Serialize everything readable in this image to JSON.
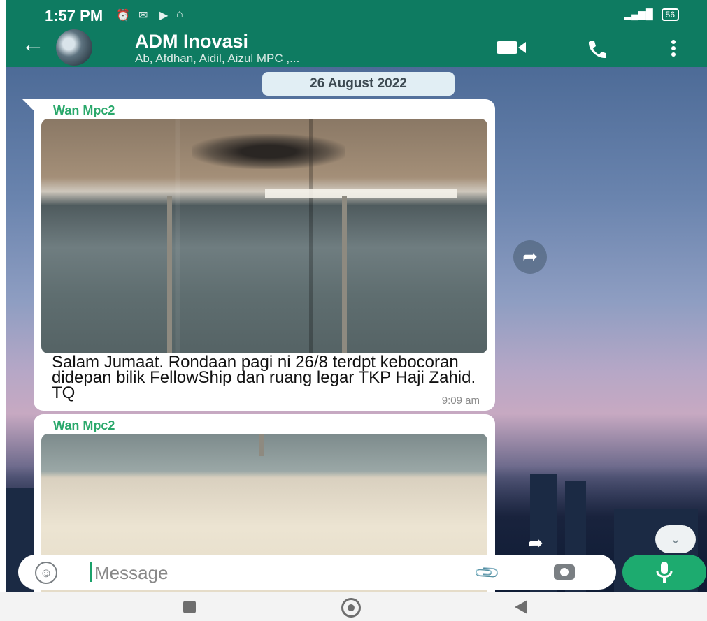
{
  "status_bar": {
    "time": "1:57 PM",
    "battery": "56"
  },
  "header": {
    "title": "ADM Inovasi",
    "subtitle": "Ab, Afdhan, Aidil, Aizul MPC ,..."
  },
  "chat": {
    "date_chip": "26 August 2022",
    "messages": [
      {
        "sender": "Wan Mpc2",
        "text": "Salam Jumaat. Rondaan pagi ni 26/8 terdpt kebocoran didepan bilik FellowShip dan ruang legar TKP Haji Zahid. TQ",
        "time": "9:09 am"
      },
      {
        "sender": "Wan Mpc2"
      }
    ]
  },
  "input": {
    "placeholder": "Message"
  },
  "colors": {
    "header": "#0e7b61",
    "sender": "#2aa86b",
    "mic": "#1dab6f"
  },
  "icons": [
    "back-arrow-icon",
    "video-call-icon",
    "phone-call-icon",
    "more-options-icon",
    "forward-icon",
    "scroll-down-icon",
    "emoji-icon",
    "attach-icon",
    "camera-icon",
    "mic-icon",
    "nav-recents-icon",
    "nav-home-icon",
    "nav-back-icon"
  ]
}
